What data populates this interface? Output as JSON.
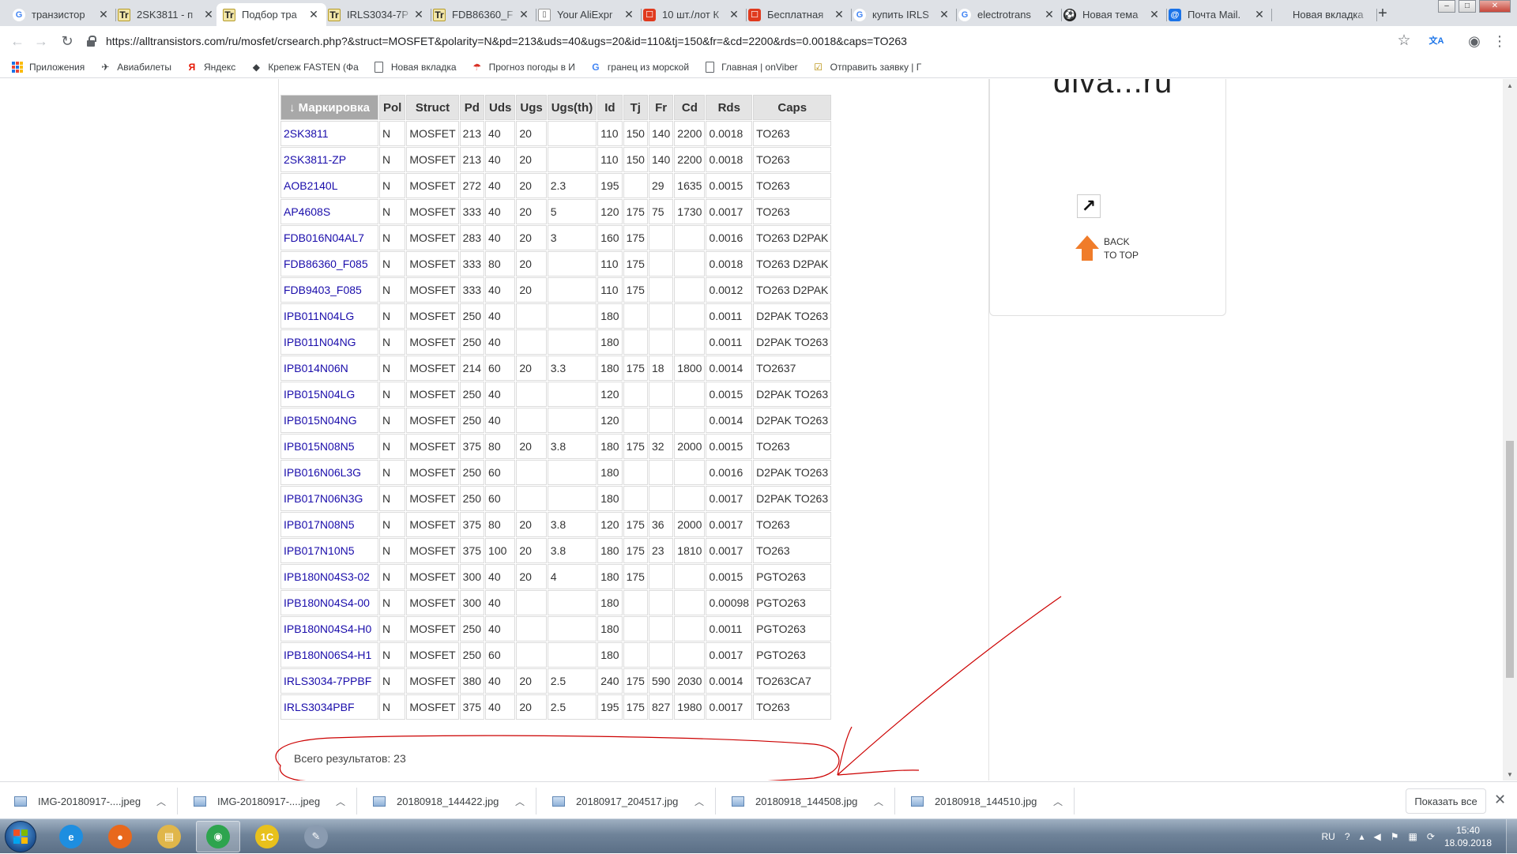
{
  "tabs": [
    {
      "title": "транзистор",
      "fav": "G",
      "fav_class": "fav-g"
    },
    {
      "title": "2SK3811 - п",
      "fav": "Tr",
      "fav_class": "fav-tr"
    },
    {
      "title": "Подбор тра",
      "fav": "Tr",
      "fav_class": "fav-tr",
      "active": true
    },
    {
      "title": "IRLS3034-7P",
      "fav": "Tr",
      "fav_class": "fav-tr"
    },
    {
      "title": "FDB86360_F",
      "fav": "Tr",
      "fav_class": "fav-tr"
    },
    {
      "title": "Your AliExpr",
      "fav": "▯",
      "fav_class": "fav-ali"
    },
    {
      "title": "10 шт./лот К",
      "fav": "☐",
      "fav_class": "fav-red"
    },
    {
      "title": "Бесплатная",
      "fav": "☐",
      "fav_class": "fav-red"
    },
    {
      "title": "купить IRLS",
      "fav": "G",
      "fav_class": "fav-g"
    },
    {
      "title": "electrotrans",
      "fav": "G",
      "fav_class": "fav-g"
    },
    {
      "title": "Новая тема",
      "fav": "⚽",
      "fav_class": "fav-ball"
    },
    {
      "title": "Почта Mail.",
      "fav": "@",
      "fav_class": "fav-mail"
    },
    {
      "title": "Новая вкладка",
      "fav": "",
      "fav_class": ""
    }
  ],
  "new_tab_label": "+",
  "window_buttons": {
    "minimize": "–",
    "maximize": "□",
    "close": "✕"
  },
  "toolbar": {
    "back": "←",
    "forward": "→",
    "reload": "↻",
    "url": "https://alltransistors.com/ru/mosfet/crsearch.php?&struct=MOSFET&polarity=N&pd=213&uds=40&ugs=20&id=110&tj=150&fr=&cd=2200&rds=0.0018&caps=TO263",
    "star": "☆",
    "translate": "文A",
    "profile": "◉",
    "menu": "⋮"
  },
  "bookmarks": [
    {
      "label": "Приложения",
      "icon": "apps-grid-icon"
    },
    {
      "label": "Авиабилеты",
      "icon": "plane-icon",
      "glyph": "✈"
    },
    {
      "label": "Яндекс",
      "icon": "yandex-icon",
      "glyph": "Я"
    },
    {
      "label": "Крепеж FASTEN (Фа",
      "icon": "fasten-icon",
      "glyph": "◆"
    },
    {
      "label": "Новая вкладка",
      "icon": "page-icon"
    },
    {
      "label": "Прогноз погоды в И",
      "icon": "weather-icon",
      "glyph": "☂"
    },
    {
      "label": "гранец из морской",
      "icon": "google-icon",
      "glyph": "G"
    },
    {
      "label": "Главная | onViber",
      "icon": "page-icon"
    },
    {
      "label": "Отправить заявку | Г",
      "icon": "form-icon",
      "glyph": "☑"
    }
  ],
  "table": {
    "headers": [
      "↓ Маркировка",
      "Pol",
      "Struct",
      "Pd",
      "Uds",
      "Ugs",
      "Ugs(th)",
      "Id",
      "Tj",
      "Fr",
      "Cd",
      "Rds",
      "Caps"
    ],
    "rows": [
      [
        "2SK3811",
        "N",
        "MOSFET",
        "213",
        "40",
        "20",
        "",
        "110",
        "150",
        "140",
        "2200",
        "0.0018",
        "TO263"
      ],
      [
        "2SK3811-ZP",
        "N",
        "MOSFET",
        "213",
        "40",
        "20",
        "",
        "110",
        "150",
        "140",
        "2200",
        "0.0018",
        "TO263"
      ],
      [
        "AOB2140L",
        "N",
        "MOSFET",
        "272",
        "40",
        "20",
        "2.3",
        "195",
        "",
        "29",
        "1635",
        "0.0015",
        "TO263"
      ],
      [
        "AP4608S",
        "N",
        "MOSFET",
        "333",
        "40",
        "20",
        "5",
        "120",
        "175",
        "75",
        "1730",
        "0.0017",
        "TO263"
      ],
      [
        "FDB016N04AL7",
        "N",
        "MOSFET",
        "283",
        "40",
        "20",
        "3",
        "160",
        "175",
        "",
        "",
        "0.0016",
        "TO263 D2PAK"
      ],
      [
        "FDB86360_F085",
        "N",
        "MOSFET",
        "333",
        "80",
        "20",
        "",
        "110",
        "175",
        "",
        "",
        "0.0018",
        "TO263 D2PAK"
      ],
      [
        "FDB9403_F085",
        "N",
        "MOSFET",
        "333",
        "40",
        "20",
        "",
        "110",
        "175",
        "",
        "",
        "0.0012",
        "TO263 D2PAK"
      ],
      [
        "IPB011N04LG",
        "N",
        "MOSFET",
        "250",
        "40",
        "",
        "",
        "180",
        "",
        "",
        "",
        "0.0011",
        "D2PAK TO263"
      ],
      [
        "IPB011N04NG",
        "N",
        "MOSFET",
        "250",
        "40",
        "",
        "",
        "180",
        "",
        "",
        "",
        "0.0011",
        "D2PAK TO263"
      ],
      [
        "IPB014N06N",
        "N",
        "MOSFET",
        "214",
        "60",
        "20",
        "3.3",
        "180",
        "175",
        "18",
        "1800",
        "0.0014",
        "TO2637"
      ],
      [
        "IPB015N04LG",
        "N",
        "MOSFET",
        "250",
        "40",
        "",
        "",
        "120",
        "",
        "",
        "",
        "0.0015",
        "D2PAK TO263"
      ],
      [
        "IPB015N04NG",
        "N",
        "MOSFET",
        "250",
        "40",
        "",
        "",
        "120",
        "",
        "",
        "",
        "0.0014",
        "D2PAK TO263"
      ],
      [
        "IPB015N08N5",
        "N",
        "MOSFET",
        "375",
        "80",
        "20",
        "3.8",
        "180",
        "175",
        "32",
        "2000",
        "0.0015",
        "TO263"
      ],
      [
        "IPB016N06L3G",
        "N",
        "MOSFET",
        "250",
        "60",
        "",
        "",
        "180",
        "",
        "",
        "",
        "0.0016",
        "D2PAK TO263"
      ],
      [
        "IPB017N06N3G",
        "N",
        "MOSFET",
        "250",
        "60",
        "",
        "",
        "180",
        "",
        "",
        "",
        "0.0017",
        "D2PAK TO263"
      ],
      [
        "IPB017N08N5",
        "N",
        "MOSFET",
        "375",
        "80",
        "20",
        "3.8",
        "120",
        "175",
        "36",
        "2000",
        "0.0017",
        "TO263"
      ],
      [
        "IPB017N10N5",
        "N",
        "MOSFET",
        "375",
        "100",
        "20",
        "3.8",
        "180",
        "175",
        "23",
        "1810",
        "0.0017",
        "TO263"
      ],
      [
        "IPB180N04S3-02",
        "N",
        "MOSFET",
        "300",
        "40",
        "20",
        "4",
        "180",
        "175",
        "",
        "",
        "0.0015",
        "PGTO263"
      ],
      [
        "IPB180N04S4-00",
        "N",
        "MOSFET",
        "300",
        "40",
        "",
        "",
        "180",
        "",
        "",
        "",
        "0.00098",
        "PGTO263"
      ],
      [
        "IPB180N04S4-H0",
        "N",
        "MOSFET",
        "250",
        "40",
        "",
        "",
        "180",
        "",
        "",
        "",
        "0.0011",
        "PGTO263"
      ],
      [
        "IPB180N06S4-H1",
        "N",
        "MOSFET",
        "250",
        "60",
        "",
        "",
        "180",
        "",
        "",
        "",
        "0.0017",
        "PGTO263"
      ],
      [
        "IRLS3034-7PPBF",
        "N",
        "MOSFET",
        "380",
        "40",
        "20",
        "2.5",
        "240",
        "175",
        "590",
        "2030",
        "0.0014",
        "TO263CA7"
      ],
      [
        "IRLS3034PBF",
        "N",
        "MOSFET",
        "375",
        "40",
        "20",
        "2.5",
        "195",
        "175",
        "827",
        "1980",
        "0.0017",
        "TO263"
      ]
    ],
    "highlighted_row": 21
  },
  "results_count": "Всего результатов: 23",
  "side_panel": {
    "logo_text": "diva...ru",
    "ext_link_glyph": "↗",
    "back_top_line1": "BACK",
    "back_top_line2": "TO TOP"
  },
  "downloads": [
    {
      "name": "IMG-20180917-....jpeg"
    },
    {
      "name": "IMG-20180917-....jpeg"
    },
    {
      "name": "20180918_144422.jpg"
    },
    {
      "name": "20180917_204517.jpg"
    },
    {
      "name": "20180918_144508.jpg"
    },
    {
      "name": "20180918_144510.jpg"
    }
  ],
  "download_shelf": {
    "show_all": "Показать все",
    "close": "✕"
  },
  "taskbar": {
    "apps": [
      {
        "name": "ie",
        "glyph": "e",
        "color": "#1e8ee0"
      },
      {
        "name": "firefox",
        "glyph": "●",
        "color": "#e8681c"
      },
      {
        "name": "explorer",
        "glyph": "▤",
        "color": "#e0b64a"
      },
      {
        "name": "chrome",
        "glyph": "◉",
        "color": "#2da44e"
      },
      {
        "name": "1c",
        "glyph": "1С",
        "color": "#e8c11c"
      },
      {
        "name": "tools",
        "glyph": "✎",
        "color": "#8a9bb0"
      }
    ],
    "lang": "RU",
    "time": "15:40",
    "date": "18.09.2018"
  },
  "annotation_color": "#cc0000"
}
